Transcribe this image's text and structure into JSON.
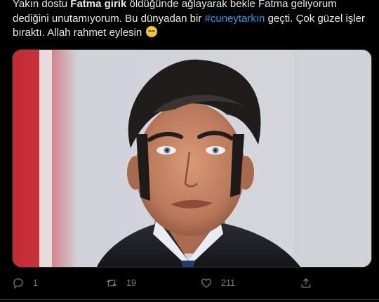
{
  "tweet": {
    "line1_pre": "Yakın dostu ",
    "line1_bold": "Fatma girik",
    "line1_post": " öldüğünde ağlayarak bekle Fatma geliyorum",
    "line2_pre": "dediğini unutamıyorum. Bu dünyadan bir ",
    "hashtag": "#cuneytarkın",
    "line2_post": " geçti. Çok güzel işler",
    "line3": "bıraktı. Allah rahmet eylesin",
    "emoji": "smiling-face-emoji"
  },
  "actions": {
    "reply_count": "1",
    "retweet_count": "19",
    "like_count": "211"
  },
  "colors": {
    "background": "#000000",
    "text": "#e7e9ea",
    "muted": "#71767b",
    "link": "#1d9bf0"
  },
  "icons": [
    "reply-icon",
    "retweet-icon",
    "like-icon",
    "share-icon"
  ]
}
